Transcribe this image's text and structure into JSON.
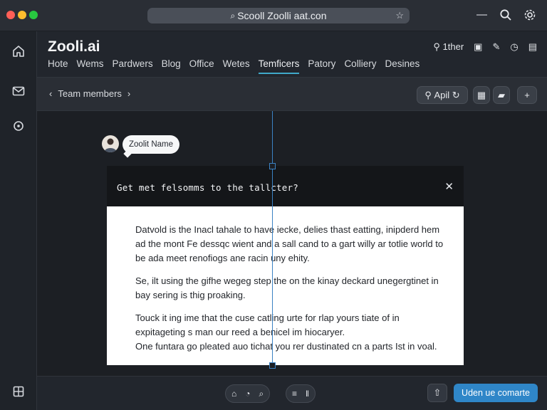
{
  "window": {
    "url": "Scooll Zoolli aat.con"
  },
  "app": {
    "brand": "Zooli.ai",
    "nav": [
      "Hote",
      "Wems",
      "Pardwers",
      "Blog",
      "Office",
      "Wetes",
      "Temficers",
      "Patory",
      "Colliery",
      "Desines"
    ],
    "active_nav": "Temficers",
    "user_label": "1ther"
  },
  "subbar": {
    "breadcrumb": "Team members",
    "api_label": "Apil"
  },
  "mention": {
    "name": "Zoolit Name"
  },
  "dialog": {
    "title": "Get met felsomms to the tallcter?",
    "paragraphs": [
      "Datvold is the Inacl tahale to have iecke, delies thast eatting, inipderd hem ad the mont Fe dessqc wient and a sall cand to a gart willy ar totlie world to be ada meet renofiogs ane racin uny ehity.",
      "Se, ilt using the gifhe wegeg step the on the kinay deckard unegergtinet in bay sering is thig proaking.",
      "Touck it ing ime that the cuse catling urte for rlap yours tiate of in expitageting s man our reed a benicel im hiocaryer.",
      "One funtara go pleated auo tichat you rer dustinated cn a parts Ist in voal."
    ]
  },
  "bottom": {
    "cta_label": "Uden ue comarte"
  },
  "colors": {
    "accent": "#2f86c8",
    "guide": "#3b82c4",
    "active_tab": "#3fa9c9"
  }
}
